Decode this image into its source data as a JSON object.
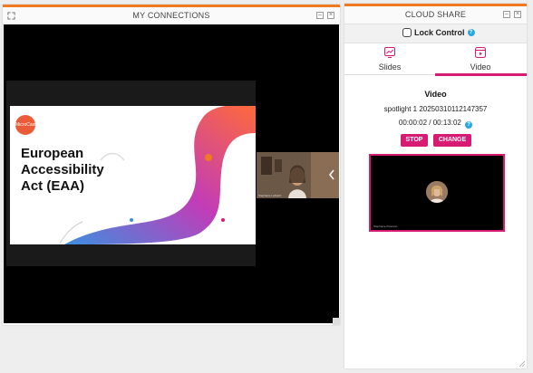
{
  "left_window": {
    "title": "MY CONNECTIONS",
    "minimize_label": "–",
    "close_label": "×",
    "slide": {
      "brand": "MicroCast",
      "title_lines": [
        "European",
        "Accessibility",
        "Act (EAA)"
      ]
    },
    "thumbnail_name": "Stephanie Leftwich"
  },
  "right_window": {
    "title": "CLOUD SHARE",
    "minimize_label": "–",
    "close_label": "×",
    "lock_control_label": "Lock Control",
    "tabs": [
      {
        "label": "Slides",
        "icon": "slides-chart-icon",
        "active": false
      },
      {
        "label": "Video",
        "icon": "video-play-icon",
        "active": true
      }
    ],
    "video": {
      "heading": "Video",
      "filename": "spotlight 1 20250310112147357",
      "time": "00:00:02 / 00:13:02",
      "stop_label": "STOP",
      "change_label": "CHANGE",
      "preview_name": "Stephanie Peterson"
    }
  },
  "colors": {
    "accent_orange": "#f07a22",
    "accent_pink": "#d81b72",
    "help_blue": "#29a8e0"
  }
}
